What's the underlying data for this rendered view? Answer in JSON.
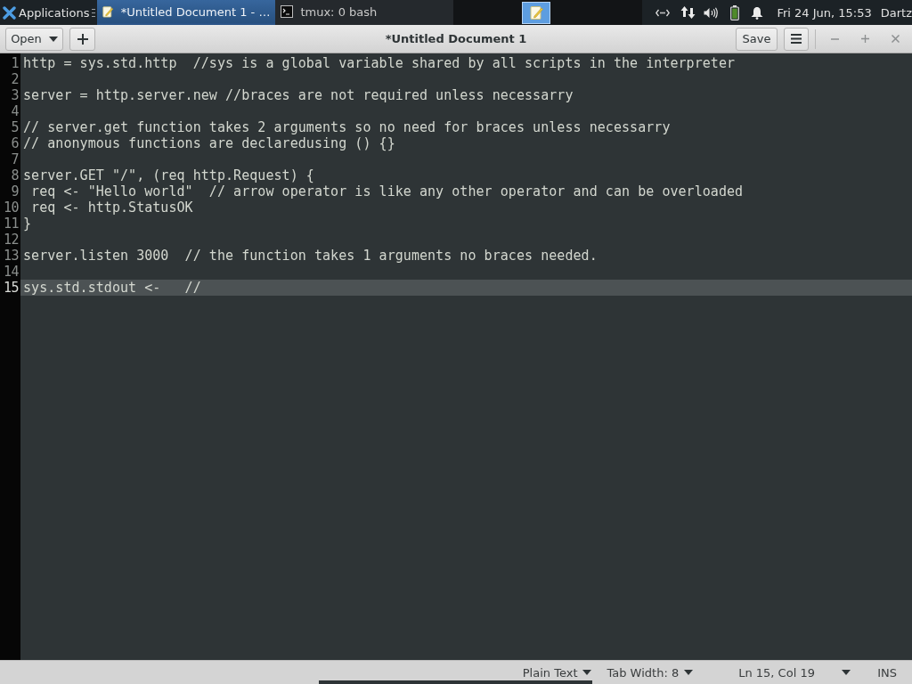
{
  "top_panel": {
    "app_menu": "Applications",
    "tasks": [
      {
        "kind": "editor",
        "label": "*Untitled Document 1 - …",
        "selected": true
      },
      {
        "kind": "terminal",
        "label": "tmux: 0 bash",
        "selected": false
      }
    ],
    "clock": "Fri 24 Jun, 15:53",
    "user": "Dartz"
  },
  "header_bar": {
    "open_button": "Open",
    "title": "*Untitled Document 1",
    "save_button": "Save"
  },
  "editor": {
    "lines": [
      {
        "number": "1",
        "text": "http = sys.std.http  //sys is a global variable shared by all scripts in the interpreter",
        "current": false
      },
      {
        "number": "2",
        "current": false
      },
      {
        "number": "3",
        "text": "server = http.server.new //braces are not required unless necessarry",
        "current": false
      },
      {
        "number": "4",
        "current": false
      },
      {
        "number": "5",
        "text": "// server.get function takes 2 arguments so no need for braces unless necessarry",
        "current": false
      },
      {
        "number": "6",
        "text": "// anonymous functions are declaredusing () {}",
        "current": false
      },
      {
        "number": "7",
        "current": false
      },
      {
        "number": "8",
        "text": "server.GET \"/\", (req http.Request) {",
        "current": false
      },
      {
        "number": "9",
        "text": " req <- \"Hello world\"  // arrow operator is like any other operator and can be overloaded",
        "current": false
      },
      {
        "number": "10",
        "text": " req <- http.StatusOK",
        "current": false
      },
      {
        "number": "11",
        "text": "}",
        "current": false
      },
      {
        "number": "12",
        "current": false
      },
      {
        "number": "13",
        "text": "server.listen 3000  // the function takes 1 arguments no braces needed.",
        "current": false
      },
      {
        "number": "14",
        "current": false
      },
      {
        "number": "15",
        "text": "sys.std.stdout <-   //",
        "current": true
      }
    ]
  },
  "status_bar": {
    "language": "Plain Text",
    "tab_width": "Tab Width: 8",
    "position": "Ln 15, Col 19",
    "mode": "INS"
  }
}
